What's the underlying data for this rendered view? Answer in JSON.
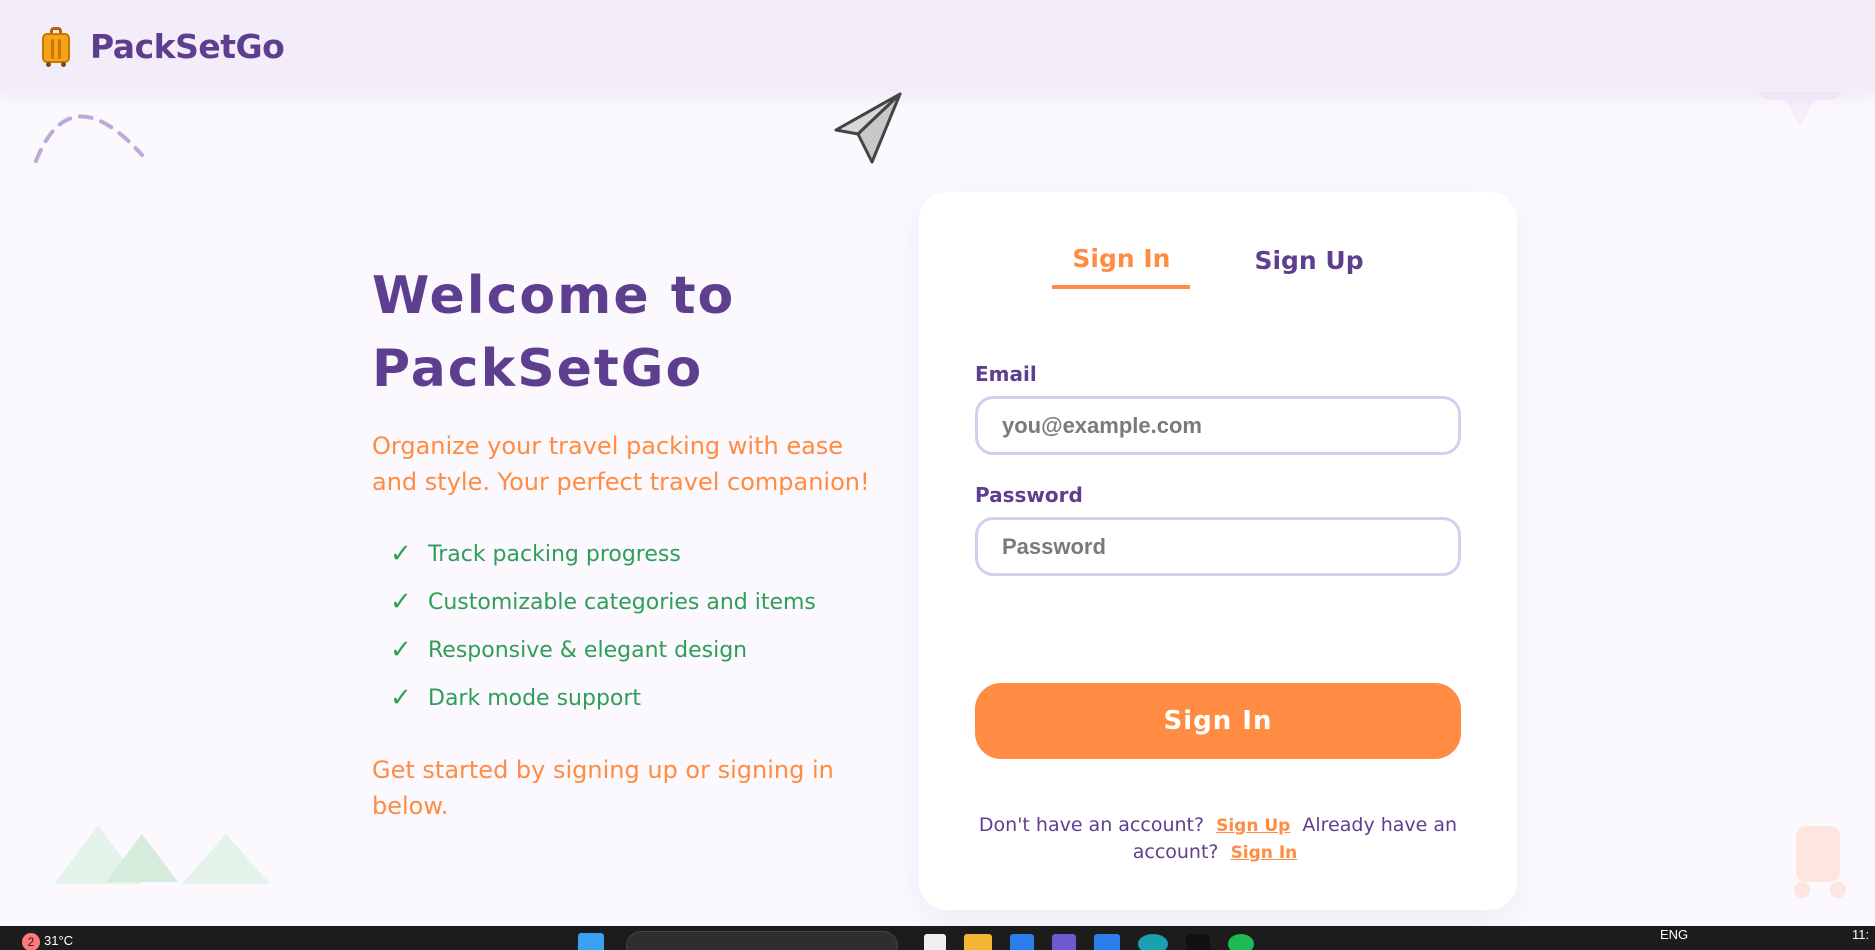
{
  "header": {
    "logo_icon": "suitcase-icon",
    "brand": "PackSetGo"
  },
  "hero": {
    "title_line1": "Welcome to",
    "title_line2": "PackSetGo",
    "subtitle": "Organize your travel packing with ease and style. Your perfect travel companion!",
    "features": [
      "Track packing progress",
      "Customizable categories and items",
      "Responsive & elegant design",
      "Dark mode support"
    ],
    "cta": "Get started by signing up or signing in below."
  },
  "auth": {
    "tabs": [
      {
        "label": "Sign In",
        "active": true
      },
      {
        "label": "Sign Up",
        "active": false
      }
    ],
    "email_label": "Email",
    "email_placeholder": "you@example.com",
    "email_value": "",
    "password_label": "Password",
    "password_placeholder": "Password",
    "password_value": "",
    "submit_label": "Sign In",
    "no_account_text": "Don't have an account?",
    "sign_up_link": "Sign Up",
    "have_account_text": "Already have an account?",
    "sign_in_link": "Sign In"
  },
  "taskbar": {
    "notification_count": "2",
    "temperature": "31°C",
    "language": "ENG",
    "time": "11:"
  },
  "colors": {
    "brand_purple": "#5e3f8f",
    "accent_orange": "#ff8c42",
    "success_green": "#2f9e58",
    "page_bg": "#fbf8fe"
  }
}
